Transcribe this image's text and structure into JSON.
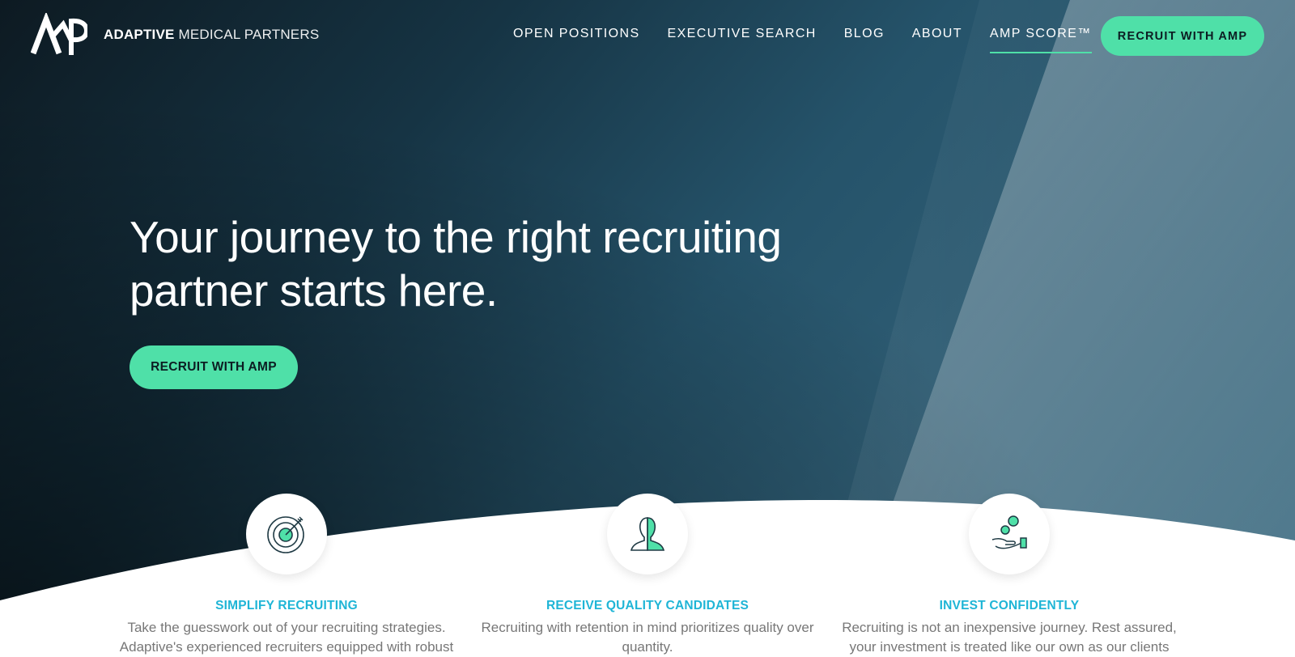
{
  "brand": {
    "strong": "ADAPTIVE",
    "light": "MEDICAL PARTNERS",
    "logo_icon": "amp-logo-icon"
  },
  "nav": {
    "items": [
      {
        "label": "OPEN POSITIONS"
      },
      {
        "label": "EXECUTIVE SEARCH"
      },
      {
        "label": "BLOG"
      },
      {
        "label": "ABOUT"
      },
      {
        "label": "AMP SCORE™",
        "active": true
      }
    ],
    "cta_label": "RECRUIT WITH AMP"
  },
  "hero": {
    "headline": "Your journey to the right recruiting partner starts here.",
    "cta_label": "RECRUIT WITH AMP"
  },
  "features": [
    {
      "icon": "target-icon",
      "title": "SIMPLIFY RECRUITING",
      "description": "Take the guesswork out of your recruiting strategies. Adaptive's experienced recruiters equipped with robust"
    },
    {
      "icon": "candidate-profile-icon",
      "title": "RECEIVE QUALITY CANDIDATES",
      "description": "Recruiting with retention in mind prioritizes quality over quantity."
    },
    {
      "icon": "hand-coins-icon",
      "title": "INVEST CONFIDENTLY",
      "description": "Recruiting is not an inexpensive journey. Rest assured, your investment is treated like our own as our clients"
    }
  ],
  "colors": {
    "accent": "#4fe0a8",
    "feature_title": "#1fb5d6",
    "hero_dark": "#0d1a22",
    "hero_mid": "#25536a"
  }
}
